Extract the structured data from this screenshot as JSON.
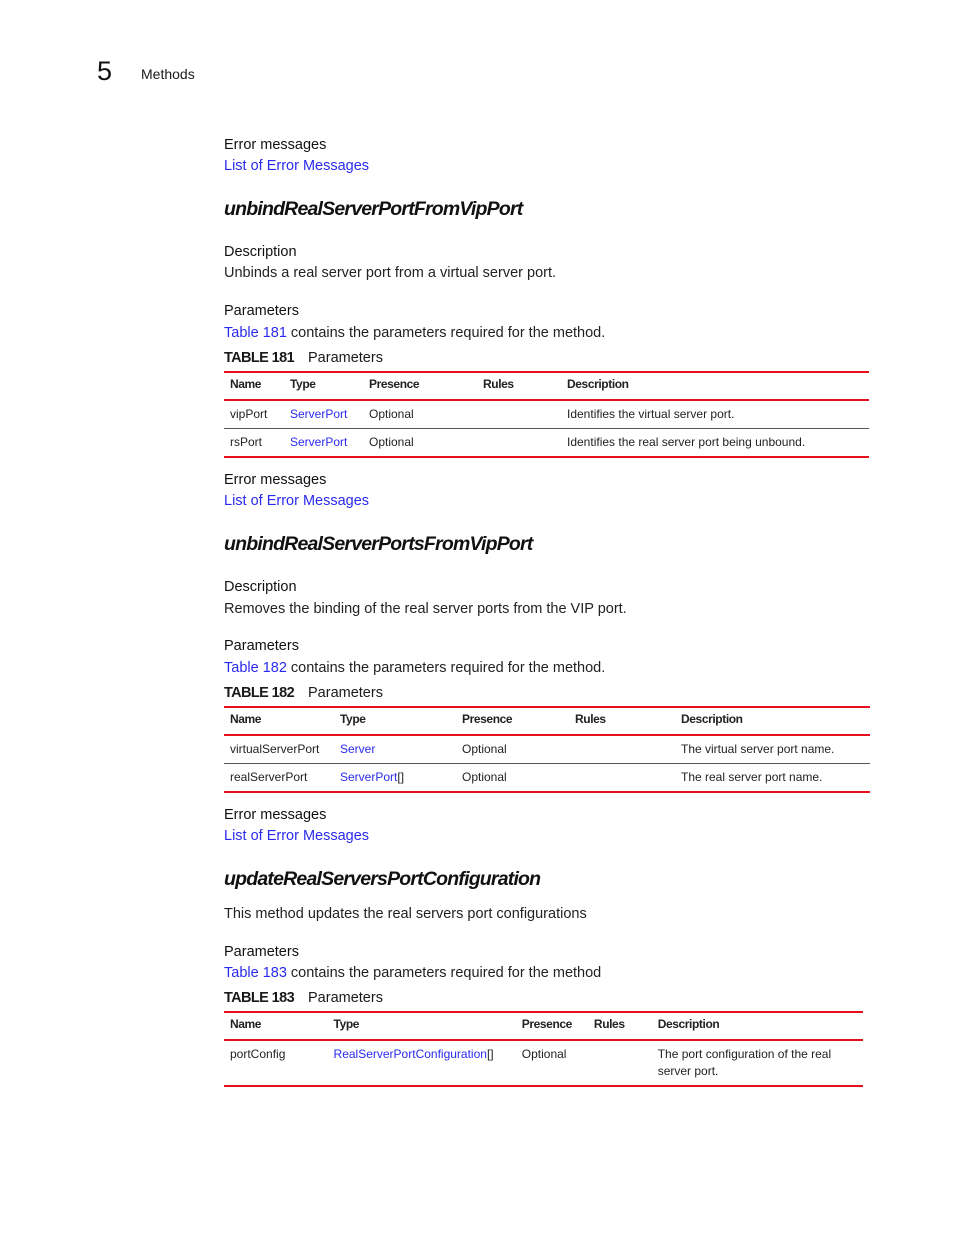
{
  "header": {
    "chapter_number": "5",
    "chapter_title": "Methods"
  },
  "top_error": {
    "heading": "Error messages",
    "link": "List of Error Messages"
  },
  "sections": [
    {
      "method": "unbindRealServerPortFromVipPort",
      "description_heading": "Description",
      "description": "Unbinds a real server port from a virtual server port.",
      "parameters_heading": "Parameters",
      "params_ref_link": "Table 181",
      "params_ref_text": " contains the parameters required for the method.",
      "table_label": "TABLE 181",
      "table_caption": "Parameters",
      "columns": [
        "Name",
        "Type",
        "Presence",
        "Rules",
        "Description"
      ],
      "rows": [
        {
          "name": "vipPort",
          "type": "ServerPort",
          "type_suffix": "",
          "presence": "Optional",
          "rules": "",
          "description": "Identifies the virtual server port."
        },
        {
          "name": "rsPort",
          "type": "ServerPort",
          "type_suffix": "",
          "presence": "Optional",
          "rules": "",
          "description": "Identifies the real server port being unbound."
        }
      ],
      "error_heading": "Error messages",
      "error_link": "List of Error Messages"
    },
    {
      "method": "unbindRealServerPortsFromVipPort",
      "description_heading": "Description",
      "description": "Removes the binding of the real server ports from the VIP port.",
      "parameters_heading": "Parameters",
      "params_ref_link": "Table 182",
      "params_ref_text": " contains the parameters required for the method.",
      "table_label": "TABLE 182",
      "table_caption": "Parameters",
      "columns": [
        "Name",
        "Type",
        "Presence",
        "Rules",
        "Description"
      ],
      "rows": [
        {
          "name": "virtualServerPort",
          "type": "Server",
          "type_suffix": "",
          "presence": "Optional",
          "rules": "",
          "description": "The virtual server port name."
        },
        {
          "name": "realServerPort",
          "type": "ServerPort",
          "type_suffix": "[]",
          "presence": "Optional",
          "rules": "",
          "description": "The real server port name."
        }
      ],
      "error_heading": "Error messages",
      "error_link": "List of Error Messages"
    },
    {
      "method": "updateRealServersPortConfiguration",
      "description": "This method updates the real servers port configurations",
      "parameters_heading": "Parameters",
      "params_ref_link": "Table 183",
      "params_ref_text": " contains the parameters required for the method",
      "table_label": "TABLE 183",
      "table_caption": "Parameters",
      "columns": [
        "Name",
        "Type",
        "Presence",
        "Rules",
        "Description"
      ],
      "rows": [
        {
          "name": "portConfig",
          "type": "RealServerPortConfiguration",
          "type_suffix": "[]",
          "presence": "Optional",
          "rules": "",
          "description": "The port configuration of the real server port."
        }
      ]
    }
  ]
}
